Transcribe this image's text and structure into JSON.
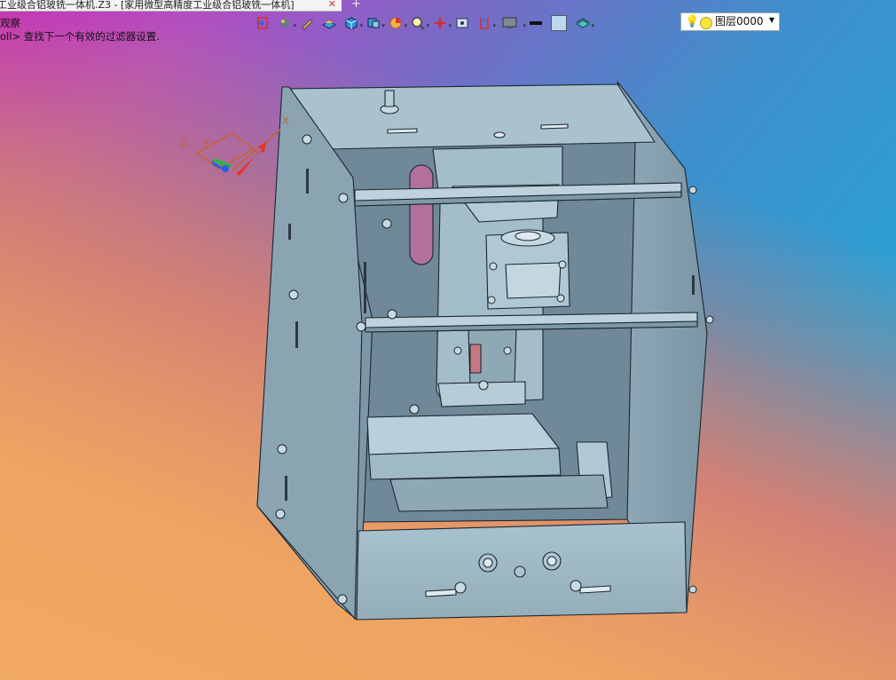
{
  "window": {
    "tab_title": "工业级合铝玻铣一体机.Z3 - [家用微型高精度工业级合铝玻铣一体机]",
    "tab_close": "✕",
    "new_tab": "+"
  },
  "command_prompt": {
    "line1": "观察",
    "line2": "oll> 查找下一个有效的过滤器设置."
  },
  "toolbar": {
    "icons": [
      "exit-icon",
      "render-icon",
      "pen-icon",
      "face-color-icon",
      "cube-icon",
      "view-cube-icon",
      "pie-filter-icon",
      "zoom-icon",
      "axis-icon",
      "image-icon",
      "bracket-icon",
      "display-icon",
      "line-type-icon",
      "color-square-icon",
      "layer-stack-icon"
    ]
  },
  "layer_selector": {
    "value": "图层0000",
    "bulb_icon": "bulb-icon",
    "state_icon": "sun-icon"
  },
  "triad": {
    "x_label": "X",
    "y_label": "Y",
    "z_label": "Z"
  },
  "colors": {
    "model_fill": "#9eb8c6",
    "model_dark": "#6d8796",
    "model_edge": "#1b2630",
    "slot_pink": "#b3709c"
  }
}
